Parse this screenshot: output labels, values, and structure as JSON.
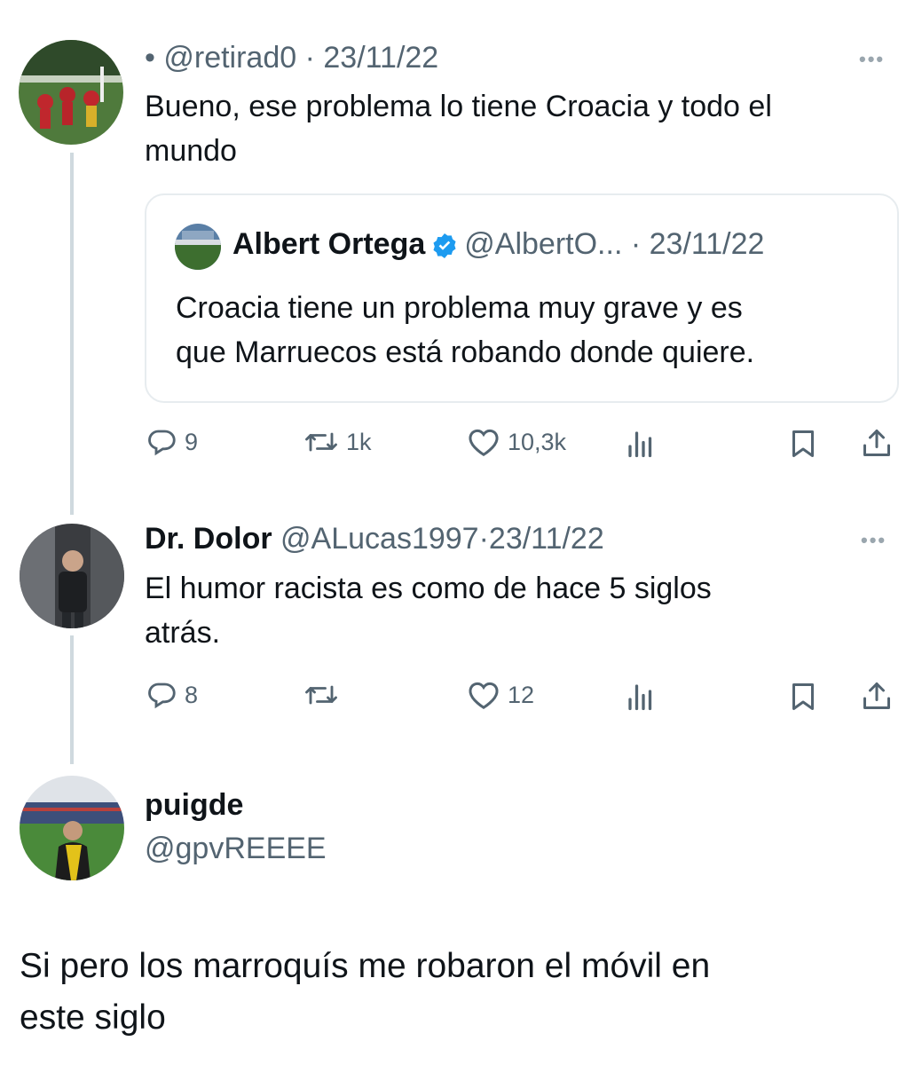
{
  "tweet1": {
    "dot": "•",
    "handle": "@retirad0",
    "sep": "·",
    "date": "23/11/22",
    "text_line1": "Bueno, ese problema lo tiene Croacia y todo el",
    "text_line2": "mundo",
    "more": "•••",
    "quote": {
      "name": "Albert Ortega",
      "handle": "@AlbertO...",
      "sep": "·",
      "date": "23/11/22",
      "text_line1": "Croacia tiene un problema muy grave y es",
      "text_line2": "que Marruecos está robando donde quiere."
    },
    "actions": {
      "replies": "9",
      "retweets": "1k",
      "likes": "10,3k"
    }
  },
  "tweet2": {
    "name": "Dr. Dolor",
    "handle": "@ALucas1997",
    "sep": "·",
    "date": "23/11/22",
    "text_line1": "El humor racista es como de hace 5 siglos",
    "text_line2": "atrás.",
    "more": "•••",
    "actions": {
      "replies": "8",
      "retweets": "",
      "likes": "12"
    }
  },
  "tweet3": {
    "name": "puigde",
    "handle": "@gpvREEEE",
    "text_line1": "Si pero los marroquís me robaron el móvil en",
    "text_line2": "este siglo"
  },
  "colors": {
    "text": "#0f1419",
    "secondary": "#536471",
    "verified": "#1d9bf0",
    "thread_line": "#cfd9de"
  },
  "icons": [
    "reply-icon",
    "retweet-icon",
    "like-icon",
    "views-icon",
    "bookmark-icon",
    "share-icon",
    "more-icon",
    "verified-badge-icon"
  ]
}
